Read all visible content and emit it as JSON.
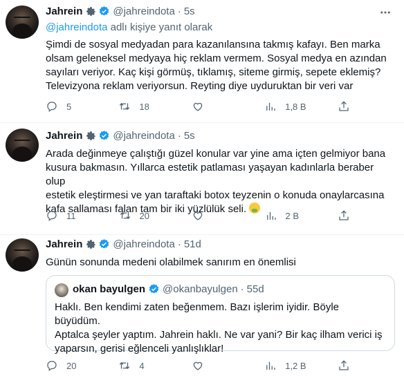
{
  "tweets": [
    {
      "name": "Jahrein",
      "handle": "@jahreindota",
      "time": "5s",
      "reply_prefix": "@jahreindota",
      "reply_suffix": " adlı kişiye yanıt olarak",
      "lines": [
        "Şimdi de sosyal medyadan para kazanılansına takmış kafayı. Ben marka",
        "olsam geleneksel medyaya hiç reklam vermem. Sosyal medya en azından",
        "sayıları veriyor. Kaç kişi görmüş, tıklamış, siteme girmiş, sepete eklemiş?",
        "Televizyona reklam veriyorsun. Reyting diye uyduruktan bir veri var"
      ],
      "replies": "5",
      "retweets": "18",
      "likes": "",
      "views": "1,8 B"
    },
    {
      "name": "Jahrein",
      "handle": "@jahreindota",
      "time": "5s",
      "lines": [
        "Arada değinmeye çalıştığı güzel konular var yine ama içten gelmiyor bana",
        "kusura bakmasın. Yıllarca estetik patlaması yaşayan kadınlarla beraber olup",
        "estetik eleştirmesi ve yan taraftaki botox teyzenin o konuda onaylarcasına",
        "kafa sallaması falan tam bir iki yüzlülük seli."
      ],
      "emoji": "nauseated-face-icon",
      "replies": "11",
      "retweets": "20",
      "likes": "",
      "views": "2 B"
    },
    {
      "name": "Jahrein",
      "handle": "@jahreindota",
      "time": "51d",
      "lines": [
        "Günün sonunda medeni olabilmek sanırım en önemlisi"
      ],
      "quote": {
        "name": "okan bayulgen",
        "handle": "@okanbayulgen",
        "time": "55d",
        "lines": [
          "Haklı. Ben kendimi zaten beğenmem. Bazı işlerim iyidir. Böyle büyüdüm.",
          "Aptalca şeyler yaptım. Jahrein haklı. Ne var yani? Bir kaç ilham verici iş",
          "yaparsın, gerisi eğlenceli yanlışlıklar!"
        ]
      },
      "replies": "20",
      "retweets": "4",
      "likes": "",
      "views": "1,2 B"
    }
  ],
  "colors": {
    "accent": "#1d9bf0",
    "muted": "#536471",
    "text": "#0f1419",
    "border": "#cfd9de"
  },
  "icons": [
    "gear-icon",
    "verified-badge-icon",
    "more-icon",
    "reply-icon",
    "retweet-icon",
    "like-icon",
    "views-icon",
    "share-icon"
  ]
}
